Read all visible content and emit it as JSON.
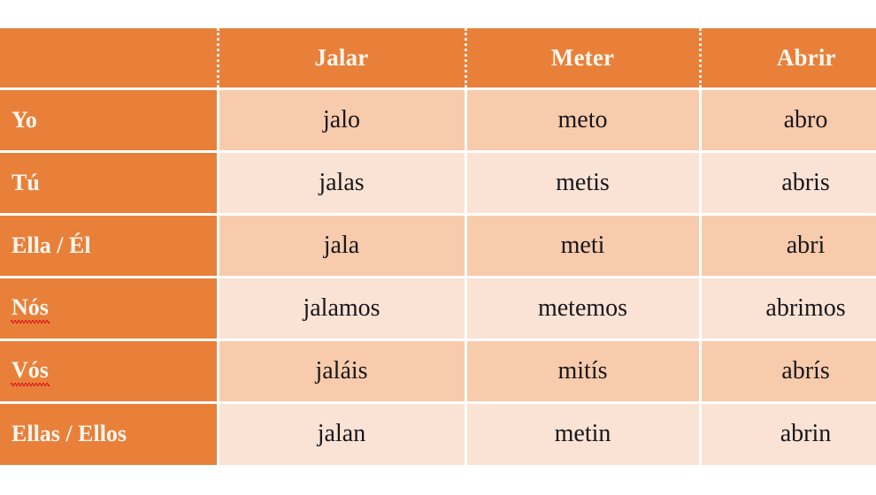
{
  "table": {
    "corner_label": "",
    "columns": [
      "Jalar",
      "Meter",
      "Abrir"
    ],
    "rows": [
      {
        "pronoun": "Yo",
        "misspelled": false,
        "forms": [
          "jalo",
          "meto",
          "abro"
        ]
      },
      {
        "pronoun": "Tú",
        "misspelled": false,
        "forms": [
          "jalas",
          "metis",
          "abris"
        ]
      },
      {
        "pronoun": "Ella / Él",
        "misspelled": false,
        "forms": [
          "jala",
          "meti",
          "abri"
        ]
      },
      {
        "pronoun": "Nós",
        "misspelled": true,
        "forms": [
          "jalamos",
          "metemos",
          "abrimos"
        ]
      },
      {
        "pronoun": "Vós",
        "misspelled": true,
        "forms": [
          "jaláis",
          "mitís",
          "abrís"
        ]
      },
      {
        "pronoun": "Ellas / Ellos",
        "misspelled": false,
        "forms": [
          "jalan",
          "metin",
          "abrin"
        ]
      }
    ]
  },
  "colors": {
    "header_orange": "#E8803A",
    "header_text": "#FDF6EE",
    "row_dark": "#F7CBAB",
    "row_light": "#FAE2D5",
    "cell_text": "#17171B",
    "gridline": "#FFFFFF",
    "spellcheck_underline": "#E02020"
  }
}
